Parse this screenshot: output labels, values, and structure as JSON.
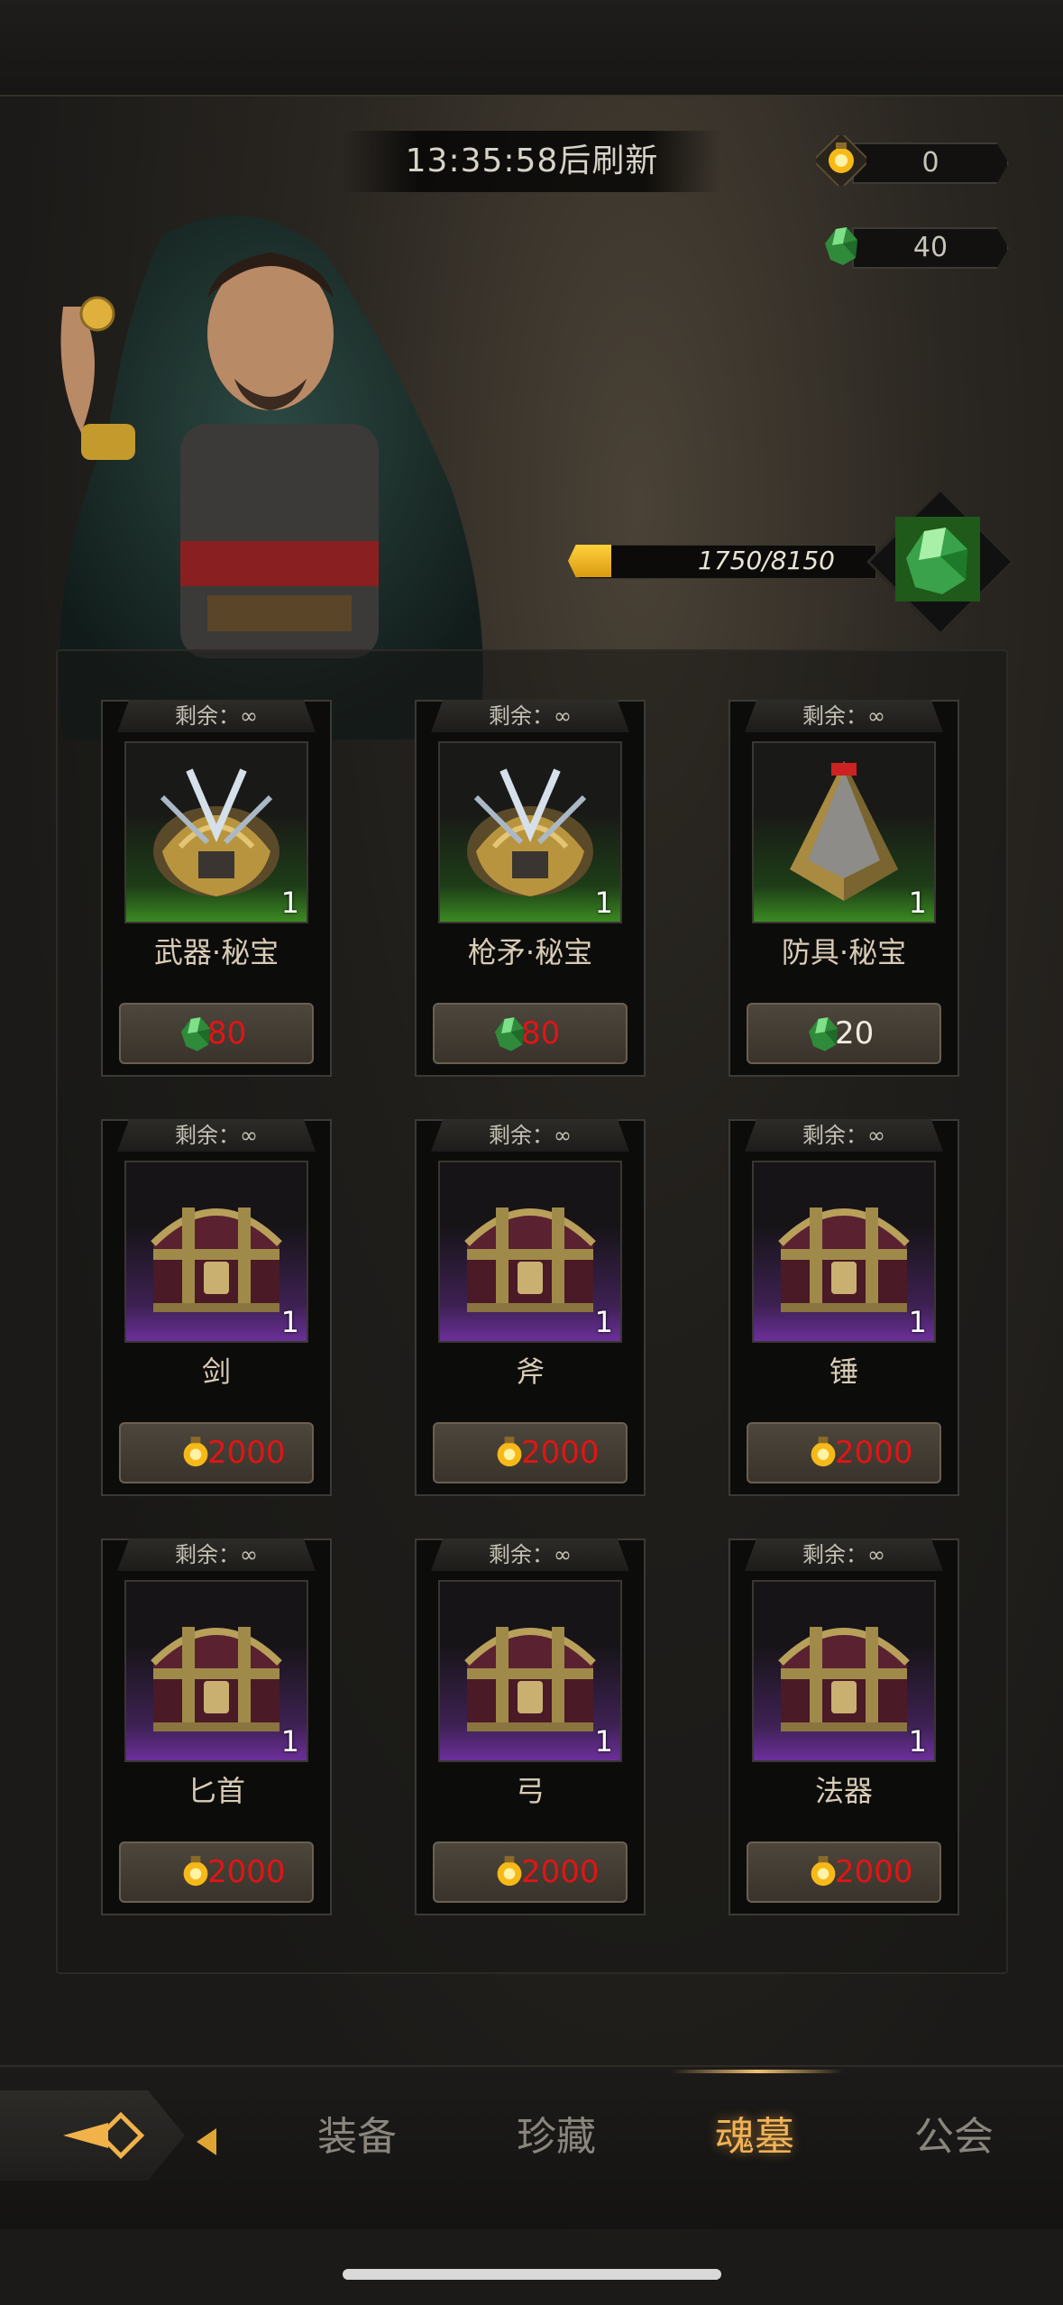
{
  "header": {
    "refresh_timer": "13:35:58后刷新"
  },
  "currencies": [
    {
      "icon": "gold-lantern-icon",
      "value": "0"
    },
    {
      "icon": "green-soul-crystal-icon",
      "value": "40"
    }
  ],
  "progress": {
    "text": "1750/8150",
    "current": 1750,
    "max": 8150,
    "reward_icon": "green-soul-crystal-icon"
  },
  "shop_items": [
    {
      "remain": "剩余：∞",
      "name": "武器·秘宝",
      "qty": "1",
      "art": "treasure-armor",
      "rarity": "green",
      "cost_icon": "green-soul-crystal-icon",
      "price": "80",
      "price_color": "red"
    },
    {
      "remain": "剩余：∞",
      "name": "枪矛·秘宝",
      "qty": "1",
      "art": "treasure-armor",
      "rarity": "green",
      "cost_icon": "green-soul-crystal-icon",
      "price": "80",
      "price_color": "red"
    },
    {
      "remain": "剩余：∞",
      "name": "防具·秘宝",
      "qty": "1",
      "art": "treasure-pyramid",
      "rarity": "green",
      "cost_icon": "green-soul-crystal-icon",
      "price": "20",
      "price_color": "white"
    },
    {
      "remain": "剩余：∞",
      "name": "剑",
      "qty": "1",
      "art": "chest",
      "rarity": "purple",
      "cost_icon": "gold-lantern-icon",
      "price": "2000",
      "price_color": "red"
    },
    {
      "remain": "剩余：∞",
      "name": "斧",
      "qty": "1",
      "art": "chest",
      "rarity": "purple",
      "cost_icon": "gold-lantern-icon",
      "price": "2000",
      "price_color": "red"
    },
    {
      "remain": "剩余：∞",
      "name": "锤",
      "qty": "1",
      "art": "chest",
      "rarity": "purple",
      "cost_icon": "gold-lantern-icon",
      "price": "2000",
      "price_color": "red"
    },
    {
      "remain": "剩余：∞",
      "name": "匕首",
      "qty": "1",
      "art": "chest",
      "rarity": "purple",
      "cost_icon": "gold-lantern-icon",
      "price": "2000",
      "price_color": "red"
    },
    {
      "remain": "剩余：∞",
      "name": "弓",
      "qty": "1",
      "art": "chest",
      "rarity": "purple",
      "cost_icon": "gold-lantern-icon",
      "price": "2000",
      "price_color": "red"
    },
    {
      "remain": "剩余：∞",
      "name": "法器",
      "qty": "1",
      "art": "chest",
      "rarity": "purple",
      "cost_icon": "gold-lantern-icon",
      "price": "2000",
      "price_color": "red"
    }
  ],
  "nav": {
    "tabs": [
      {
        "label": "装备",
        "active": false
      },
      {
        "label": "珍藏",
        "active": false
      },
      {
        "label": "魂墓",
        "active": true
      },
      {
        "label": "公会",
        "active": false
      }
    ]
  },
  "colors": {
    "price_red": "#e01515",
    "active_tab": "#f0b257",
    "progress_fill": "#f2b81f"
  }
}
